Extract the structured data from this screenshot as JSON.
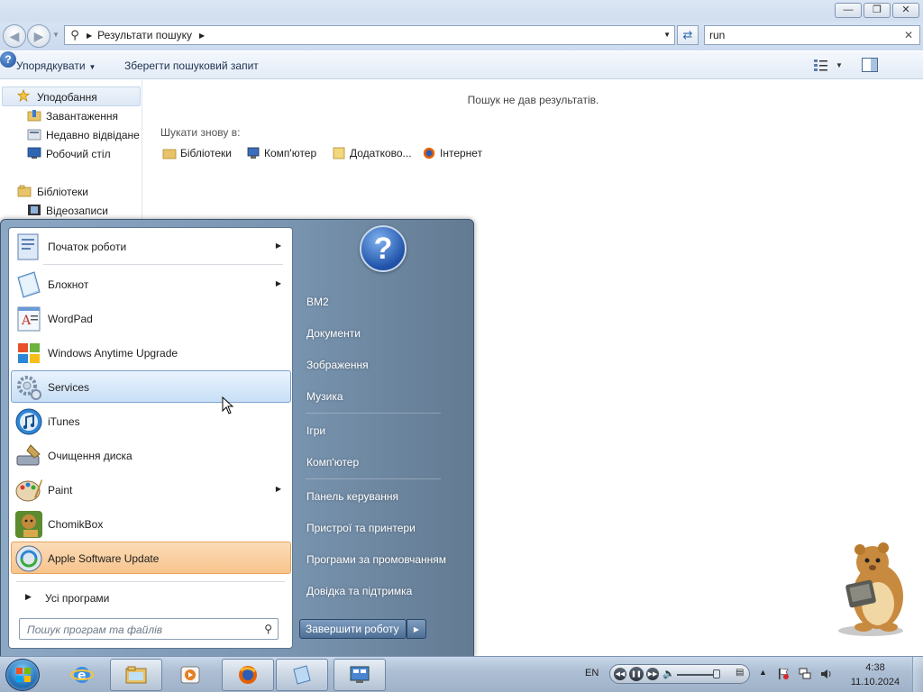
{
  "explorer": {
    "address_crumb": "Результати пошуку",
    "search_value": "run",
    "toolbar": {
      "organize": "Упорядкувати",
      "save_search": "Зберегти пошуковий запит"
    },
    "nav": {
      "favorites": "Уподобання",
      "downloads": "Завантаження",
      "recent": "Недавно відвідане",
      "desktop": "Робочий стіл",
      "libraries": "Бібліотеки",
      "videos": "Відеозаписи"
    },
    "content": {
      "no_results": "Пошук не дав результатів.",
      "search_again": "Шукати знову в:",
      "locations": [
        "Бібліотеки",
        "Комп'ютер",
        "Додатково...",
        "Інтернет"
      ]
    }
  },
  "start_menu": {
    "programs": [
      {
        "label": "Початок роботи",
        "submenu": true
      },
      {
        "label": "Блокнот",
        "submenu": true
      },
      {
        "label": "WordPad",
        "submenu": false
      },
      {
        "label": "Windows Anytime Upgrade",
        "submenu": false
      },
      {
        "label": "Services",
        "submenu": false
      },
      {
        "label": "iTunes",
        "submenu": false
      },
      {
        "label": "Очищення диска",
        "submenu": false
      },
      {
        "label": "Paint",
        "submenu": true
      },
      {
        "label": "ChomikBox",
        "submenu": false
      },
      {
        "label": "Apple Software Update",
        "submenu": false
      }
    ],
    "all_programs": "Усі програми",
    "search_placeholder": "Пошук програм та файлів",
    "right_links": [
      "BM2",
      "Документи",
      "Зображення",
      "Музика",
      "Ігри",
      "Комп'ютер",
      "Панель керування",
      "Пристрої та принтери",
      "Програми за промовчанням",
      "Довідка та підтримка"
    ],
    "shutdown": "Завершити роботу"
  },
  "taskbar": {
    "language": "EN",
    "time": "4:38",
    "date": "11.10.2024"
  },
  "colors": {
    "hover_blue": "#c8dff6",
    "newly_installed_orange": "#f7c48c",
    "taskbar": "#aebfd4"
  },
  "icons": [
    "search-icon",
    "refresh-icon",
    "help-icon",
    "star-icon",
    "folder-icon",
    "computer-icon",
    "firefox-icon",
    "internet-explorer-icon",
    "volume-icon",
    "flag-icon",
    "network-icon"
  ]
}
